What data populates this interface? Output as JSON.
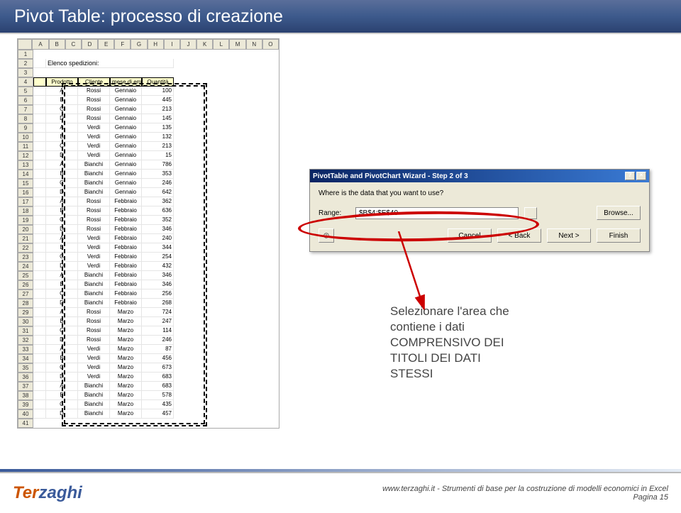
{
  "slide": {
    "title": "Pivot Table: processo di creazione"
  },
  "sheet": {
    "columns": [
      "A",
      "B",
      "C",
      "D",
      "E",
      "F",
      "G",
      "H",
      "I",
      "J",
      "K",
      "L",
      "M",
      "N",
      "O"
    ],
    "heading": "Elenco spedizioni:",
    "headers": [
      "Prodotto",
      "Cliente",
      "mese di emissione",
      "Quantità"
    ],
    "rows": [
      [
        "A",
        "Rossi",
        "Gennaio",
        "100"
      ],
      [
        "B",
        "Rossi",
        "Gennaio",
        "445"
      ],
      [
        "C",
        "Rossi",
        "Gennaio",
        "213"
      ],
      [
        "D",
        "Rossi",
        "Gennaio",
        "145"
      ],
      [
        "A",
        "Verdi",
        "Gennaio",
        "135"
      ],
      [
        "B",
        "Verdi",
        "Gennaio",
        "132"
      ],
      [
        "C",
        "Verdi",
        "Gennaio",
        "213"
      ],
      [
        "D",
        "Verdi",
        "Gennaio",
        "15"
      ],
      [
        "A",
        "Bianchi",
        "Gennaio",
        "786"
      ],
      [
        "B",
        "Bianchi",
        "Gennaio",
        "353"
      ],
      [
        "C",
        "Bianchi",
        "Gennaio",
        "246"
      ],
      [
        "D",
        "Bianchi",
        "Gennaio",
        "642"
      ],
      [
        "A",
        "Rossi",
        "Febbraio",
        "362"
      ],
      [
        "B",
        "Rossi",
        "Febbraio",
        "636"
      ],
      [
        "C",
        "Rossi",
        "Febbraio",
        "352"
      ],
      [
        "D",
        "Rossi",
        "Febbraio",
        "346"
      ],
      [
        "A",
        "Verdi",
        "Febbraio",
        "240"
      ],
      [
        "B",
        "Verdi",
        "Febbraio",
        "344"
      ],
      [
        "C",
        "Verdi",
        "Febbraio",
        "254"
      ],
      [
        "D",
        "Verdi",
        "Febbraio",
        "432"
      ],
      [
        "A",
        "Bianchi",
        "Febbraio",
        "346"
      ],
      [
        "B",
        "Bianchi",
        "Febbraio",
        "346"
      ],
      [
        "C",
        "Bianchi",
        "Febbraio",
        "256"
      ],
      [
        "D",
        "Bianchi",
        "Febbraio",
        "268"
      ],
      [
        "A",
        "Rossi",
        "Marzo",
        "724"
      ],
      [
        "B",
        "Rossi",
        "Marzo",
        "247"
      ],
      [
        "C",
        "Rossi",
        "Marzo",
        "114"
      ],
      [
        "D",
        "Rossi",
        "Marzo",
        "246"
      ],
      [
        "A",
        "Verdi",
        "Marzo",
        "87"
      ],
      [
        "B",
        "Verdi",
        "Marzo",
        "456"
      ],
      [
        "C",
        "Verdi",
        "Marzo",
        "673"
      ],
      [
        "D",
        "Verdi",
        "Marzo",
        "683"
      ],
      [
        "A",
        "Bianchi",
        "Marzo",
        "683"
      ],
      [
        "B",
        "Bianchi",
        "Marzo",
        "578"
      ],
      [
        "C",
        "Bianchi",
        "Marzo",
        "435"
      ],
      [
        "D",
        "Bianchi",
        "Marzo",
        "457"
      ]
    ]
  },
  "dialog": {
    "title": "PivotTable and PivotChart Wizard - Step 2 of 3",
    "prompt": "Where is the data that you want to use?",
    "range_label": "Range:",
    "range_value": "$B$4:$E$40",
    "browse": "Browse...",
    "cancel": "Cancel",
    "back": "< Back",
    "next": "Next >",
    "finish": "Finish",
    "help": "?",
    "close": "×"
  },
  "annotation": {
    "line1": "Selezionare l'area che",
    "line2": "contiene i dati",
    "line3": "COMPRENSIVO DEI",
    "line4": "TITOLI DEI DATI",
    "line5": "STESSI"
  },
  "footer": {
    "logo1": "Ter",
    "logo2": "zaghi",
    "credits": "www.terzaghi.it - Strumenti di base per la costruzione di modelli economici in Excel",
    "page": "Pagina 15"
  }
}
